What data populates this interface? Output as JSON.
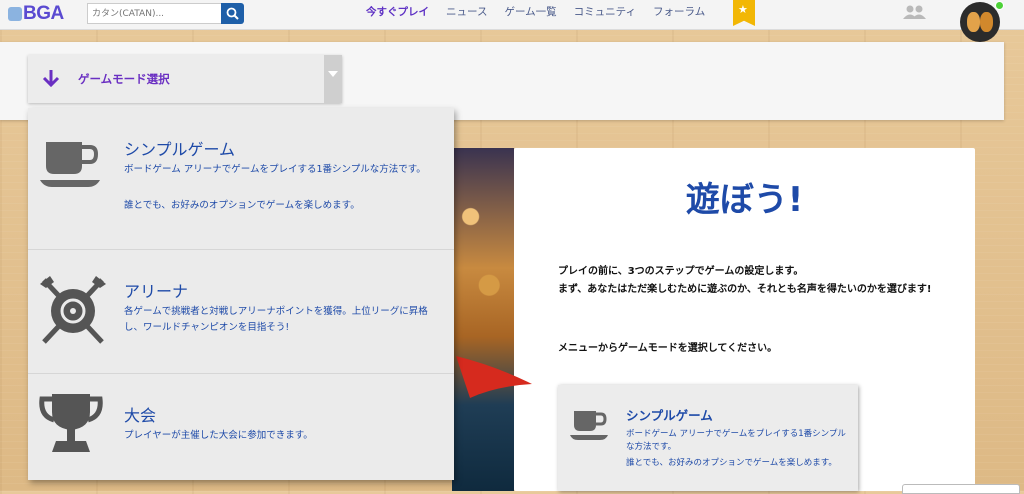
{
  "header": {
    "logo": "BGA",
    "search_placeholder": "カタン(CATAN)...",
    "nav": [
      {
        "label": "今すぐプレイ",
        "active": true
      },
      {
        "label": "ニュース"
      },
      {
        "label": "ゲーム一覧"
      },
      {
        "label": "コミュニティ"
      },
      {
        "label": "フォーラム"
      }
    ],
    "accent_color": "#5e31c4",
    "bookmark_color": "#f2b705"
  },
  "mode_select": {
    "label": "ゲームモード選択",
    "arrow_icon": "arrow-down-icon"
  },
  "dropdown": {
    "options": [
      {
        "icon": "coffee-cup-icon",
        "title": "シンプルゲーム",
        "desc": "ボードゲーム アリーナでゲームをプレイする1番シンプルな方法です。",
        "desc2": "誰とでも、お好みのオプションでゲームを楽しめます。"
      },
      {
        "icon": "crossed-swords-shield-icon",
        "title": "アリーナ",
        "desc": "各ゲームで挑戦者と対戦しアリーナポイントを獲得。上位リーグに昇格し、ワールドチャンピオンを目指そう!"
      },
      {
        "icon": "trophy-icon",
        "title": "大会",
        "desc": "プレイヤーが主催した大会に参加できます。"
      }
    ]
  },
  "main": {
    "title": "遊ぼう!",
    "p1": "プレイの前に、3つのステップでゲームの設定します。",
    "p2": "まず、あなたはただ楽しむために遊ぶのか、それとも名声を得たいのかを選びます!",
    "p3": "メニューからゲームモードを選択してください。",
    "mini_card": {
      "icon": "coffee-cup-icon",
      "title": "シンプルゲーム",
      "desc": "ボードゲーム アリーナでゲームをプレイする1番シンプルな方法です。",
      "desc2": "誰とでも、お好みのオプションでゲームを楽しめます。"
    },
    "title_color": "#1e4aa8"
  }
}
